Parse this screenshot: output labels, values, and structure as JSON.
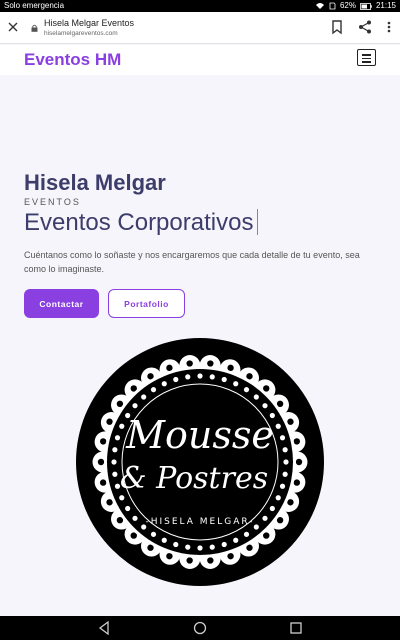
{
  "status_bar": {
    "carrier": "Solo emergencia",
    "battery": "62%",
    "time": "21:15"
  },
  "browser": {
    "page_title": "Hisela Melgar Eventos",
    "url": "hiselamelgareventos.com"
  },
  "site": {
    "brand": "Eventos HM"
  },
  "hero": {
    "name": "Hisela Melgar",
    "kicker": "EVENTOS",
    "typed": "Eventos Corporativos",
    "description": "Cuéntanos como lo soñaste y nos encargaremos que cada detalle de tu evento, sea como lo imaginaste.",
    "primary_button": "Contactar",
    "secondary_button": "Portafolio"
  },
  "logo": {
    "line1": "Mousse",
    "line2": "& Postres",
    "tagline": "-HISELA MELGAR-"
  },
  "colors": {
    "accent": "#8a3fe0",
    "heading": "#3d3d6b"
  }
}
